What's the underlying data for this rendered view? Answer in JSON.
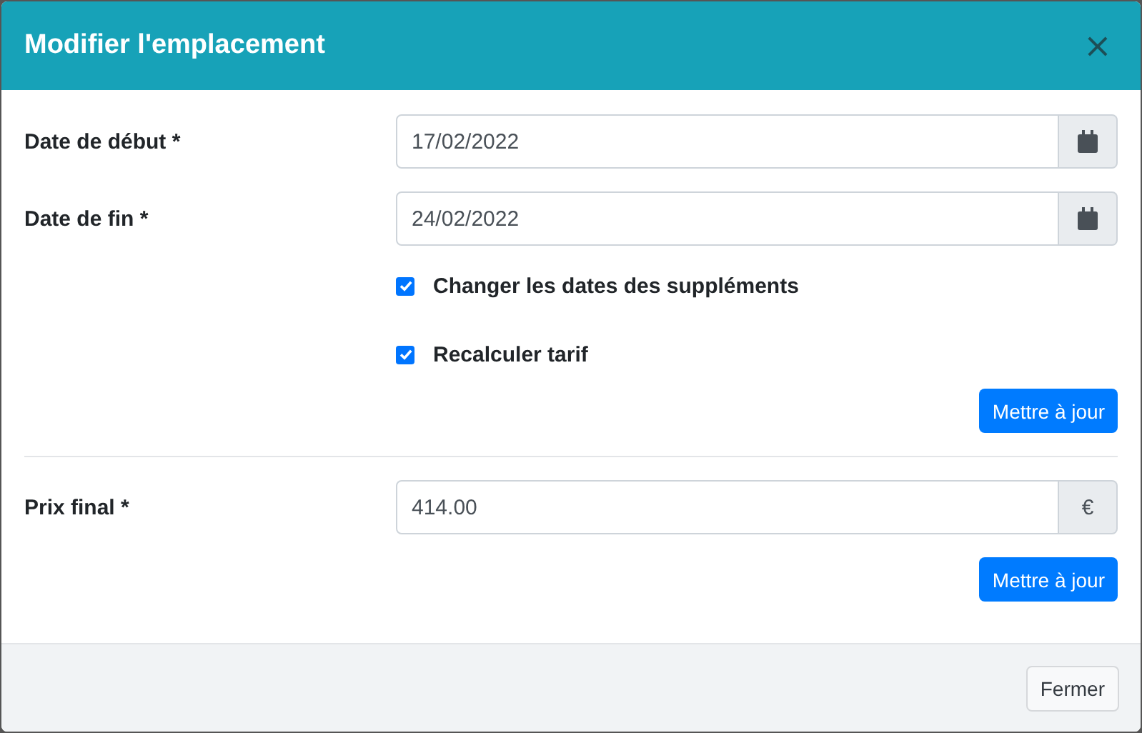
{
  "header": {
    "title": "Modifier l'emplacement",
    "close": "×"
  },
  "date_fields": [
    {
      "label": "Date de début *",
      "value": "17/02/2022",
      "addon": {
        "kind": "calendar"
      }
    },
    {
      "label": "Date de fin *",
      "value": "24/02/2022",
      "addon": {
        "kind": "calendar"
      }
    }
  ],
  "options": [
    {
      "label": "Changer les dates des suppléments",
      "checked": true
    },
    {
      "label": "Recalculer tarif",
      "checked": true
    }
  ],
  "update_button": "Mettre à jour",
  "price_field": {
    "label": "Prix final *",
    "value": "414.00",
    "addon": {
      "kind": "text",
      "text": "€"
    }
  },
  "price_update_button": "Mettre à jour",
  "footer": {
    "close_button": "Fermer"
  }
}
